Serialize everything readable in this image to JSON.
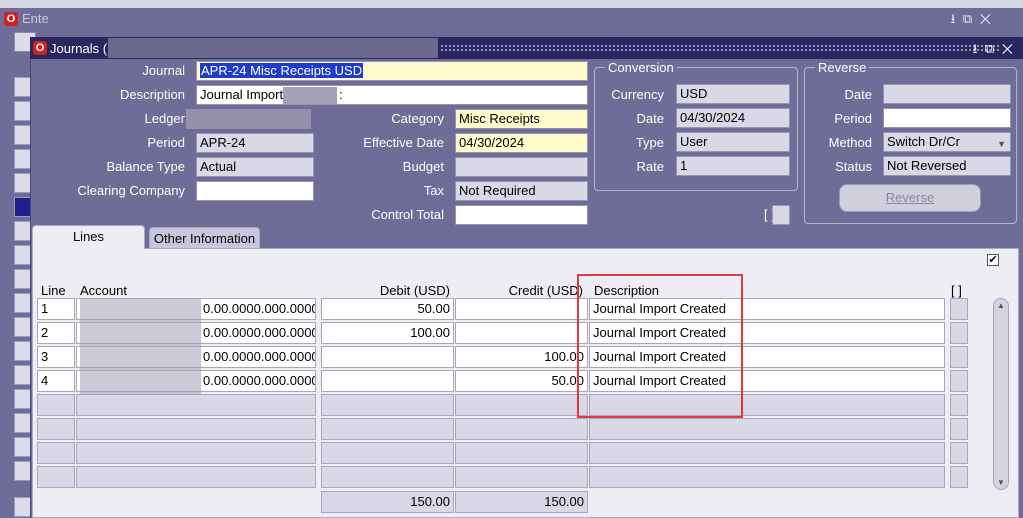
{
  "app": {
    "outer_title": "Ente",
    "window_title": "Journals ("
  },
  "header": {
    "journal_label": "Journal",
    "journal": "APR-24 Misc Receipts USD",
    "description_label": "Description",
    "description_start": "Journal Import",
    "description_end": ":",
    "ledger_label": "Ledger",
    "period_label": "Period",
    "period": "APR-24",
    "balance_type_label": "Balance Type",
    "balance_type": "Actual",
    "clearing_company_label": "Clearing Company",
    "clearing_company": "",
    "category_label": "Category",
    "category": "Misc Receipts",
    "effective_date_label": "Effective Date",
    "effective_date": "04/30/2024",
    "budget_label": "Budget",
    "budget": "",
    "tax_label": "Tax",
    "tax": "Not Required",
    "control_total_label": "Control Total",
    "control_total": ""
  },
  "conversion": {
    "title": "Conversion",
    "currency_label": "Currency",
    "currency": "USD",
    "date_label": "Date",
    "date": "04/30/2024",
    "type_label": "Type",
    "type": "User",
    "rate_label": "Rate",
    "rate": "1",
    "bracket": "[ ]"
  },
  "reverse": {
    "title": "Reverse",
    "date_label": "Date",
    "date": "",
    "period_label": "Period",
    "period": "",
    "method_label": "Method",
    "method": "Switch Dr/Cr",
    "status_label": "Status",
    "status": "Not Reversed",
    "button": "Reverse"
  },
  "tabs": [
    {
      "label": "Lines"
    },
    {
      "label": "Other Information"
    }
  ],
  "lines": {
    "columns": {
      "line": "Line",
      "account": "Account",
      "debit": "Debit (USD)",
      "credit": "Credit (USD)",
      "description": "Description",
      "flex": "[ ]"
    },
    "rows": [
      {
        "line": "1",
        "account": "0.00.0000.000.0000",
        "debit": "50.00",
        "credit": "",
        "description": "Journal Import Created"
      },
      {
        "line": "2",
        "account": "0.00.0000.000.0000",
        "debit": "100.00",
        "credit": "",
        "description": "Journal Import Created"
      },
      {
        "line": "3",
        "account": "0.00.0000.000.0000",
        "debit": "",
        "credit": "100.00",
        "description": "Journal Import Created"
      },
      {
        "line": "4",
        "account": "0.00.0000.000.0000",
        "debit": "",
        "credit": "50.00",
        "description": "Journal Import Created"
      }
    ],
    "total_debit": "150.00",
    "total_credit": "150.00",
    "checkbox_mark": "✔"
  },
  "colors": {
    "highlight_box": "#e0393e",
    "title_bar": "#2a2660",
    "required_field": "#fffbcd"
  }
}
